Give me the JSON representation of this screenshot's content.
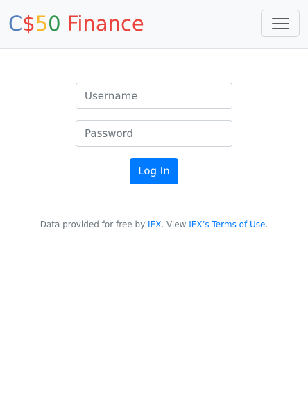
{
  "navbar": {
    "brand_parts": [
      {
        "text": "C",
        "color": "#537fbe"
      },
      {
        "text": "$",
        "color": "#ea433b"
      },
      {
        "text": "5",
        "color": "#f5b82e"
      },
      {
        "text": "0",
        "color": "#2e944b"
      },
      {
        "text": " Finance",
        "color": "#ea433b"
      }
    ],
    "toggler_icon": "hamburger-menu-icon"
  },
  "form": {
    "username_placeholder": "Username",
    "password_placeholder": "Password",
    "submit_label": "Log In",
    "submit_color": "#007bff"
  },
  "footer": {
    "text_before": "Data provided for free by ",
    "iex_link": "IEX",
    "text_middle": ". View ",
    "terms_link": "IEX’s Terms of Use",
    "text_after": ".",
    "link_color": "#007bff"
  }
}
